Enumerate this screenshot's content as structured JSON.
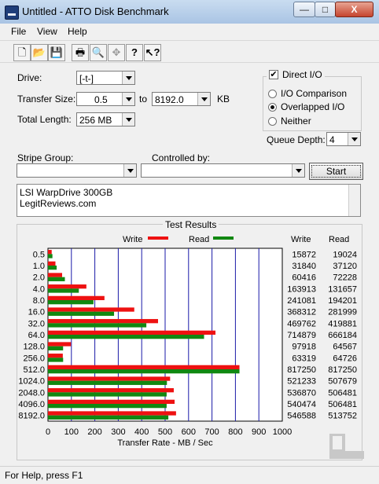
{
  "window": {
    "title": "Untitled - ATTO Disk Benchmark",
    "minimize": "—",
    "maximize": "□",
    "close": "X"
  },
  "menu": [
    "File",
    "View",
    "Help"
  ],
  "toolbar_icons": [
    "new-icon",
    "open-icon",
    "save-icon",
    "print-icon",
    "print-preview-icon",
    "move-icon",
    "help-icon",
    "context-help-icon"
  ],
  "form": {
    "drive_label": "Drive:",
    "drive_value": "[-t-]",
    "transfer_size_label": "Transfer Size:",
    "transfer_from": "0.5",
    "to_label": "to",
    "transfer_to": "8192.0",
    "kb_label": "KB",
    "total_length_label": "Total Length:",
    "total_length_value": "256 MB",
    "direct_io_label": "Direct I/O",
    "direct_io_checked": true,
    "io_options": [
      {
        "label": "I/O Comparison",
        "selected": false
      },
      {
        "label": "Overlapped I/O",
        "selected": true
      },
      {
        "label": "Neither",
        "selected": false
      }
    ],
    "queue_depth_label": "Queue Depth:",
    "queue_depth_value": "4",
    "stripe_group_label": "Stripe Group:",
    "stripe_group_value": "",
    "controlled_by_label": "Controlled by:",
    "controlled_by_value": "",
    "start_label": "Start"
  },
  "notes": [
    "LSI WarpDrive 300GB",
    "LegitReviews.com"
  ],
  "results": {
    "title": "Test Results",
    "write_legend": "Write",
    "read_legend": "Read",
    "write_header": "Write",
    "read_header": "Read",
    "write_color": "#ee1111",
    "read_color": "#118811",
    "xlabel": "Transfer Rate - MB / Sec"
  },
  "chart_data": {
    "type": "bar",
    "orientation": "horizontal",
    "title": "Test Results",
    "xlabel": "Transfer Rate - MB / Sec",
    "xlim": [
      0,
      1000
    ],
    "xticks": [
      0,
      100,
      200,
      300,
      400,
      500,
      600,
      700,
      800,
      900,
      1000
    ],
    "categories": [
      "0.5",
      "1.0",
      "2.0",
      "4.0",
      "8.0",
      "16.0",
      "32.0",
      "64.0",
      "128.0",
      "256.0",
      "512.0",
      "1024.0",
      "2048.0",
      "4096.0",
      "8192.0"
    ],
    "series": [
      {
        "name": "Write",
        "values": [
          15872,
          31840,
          60416,
          163913,
          241081,
          368312,
          469762,
          714879,
          97918,
          63319,
          817250,
          521233,
          536870,
          540474,
          546588
        ]
      },
      {
        "name": "Read",
        "values": [
          19024,
          37120,
          72228,
          131657,
          194201,
          281999,
          419881,
          666184,
          64567,
          64726,
          817250,
          507679,
          506481,
          506481,
          513752
        ]
      }
    ],
    "legend_position": "top",
    "grid": true
  },
  "status": "For Help, press F1"
}
